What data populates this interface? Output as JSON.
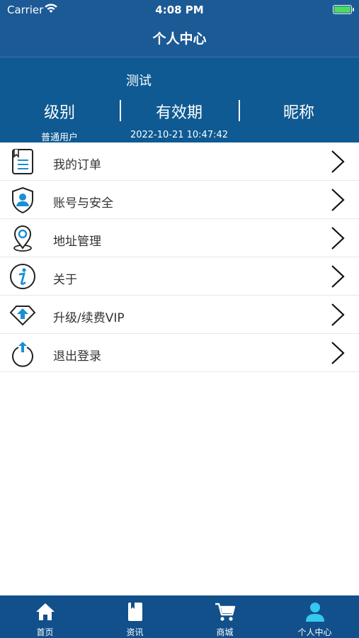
{
  "status_bar": {
    "carrier": "Carrier",
    "time": "4:08 PM"
  },
  "nav": {
    "title": "个人中心"
  },
  "profile": {
    "username": "测试",
    "columns": [
      {
        "heading": "级别",
        "value": "普通用户"
      },
      {
        "heading": "有效期",
        "value": "2022-10-21 10:47:42"
      },
      {
        "heading": "昵称",
        "value": ""
      }
    ]
  },
  "menu": [
    {
      "label": "我的订单",
      "icon": "order-list-icon"
    },
    {
      "label": "账号与安全",
      "icon": "shield-user-icon"
    },
    {
      "label": "地址管理",
      "icon": "location-pin-icon"
    },
    {
      "label": "关于",
      "icon": "info-icon"
    },
    {
      "label": "升级/续费VIP",
      "icon": "upgrade-diamond-icon"
    },
    {
      "label": "退出登录",
      "icon": "logout-icon"
    }
  ],
  "tabs": [
    {
      "label": "首页",
      "icon": "home-icon"
    },
    {
      "label": "资讯",
      "icon": "news-book-icon"
    },
    {
      "label": "商城",
      "icon": "cart-icon"
    },
    {
      "label": "个人中心",
      "icon": "user-icon",
      "active": true
    }
  ],
  "colors": {
    "header": "#1c5a96",
    "profile_bg": "#0f5a92",
    "tabbar": "#11508a",
    "icon_accent": "#1a8fd6"
  }
}
